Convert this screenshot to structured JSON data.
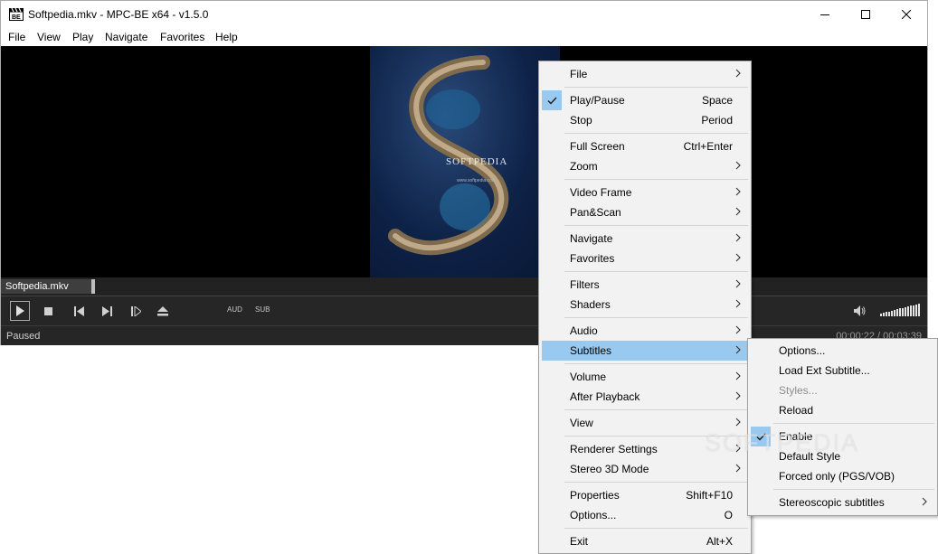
{
  "window": {
    "title": "Softpedia.mkv - MPC-BE x64 - v1.5.0",
    "menu": [
      "File",
      "View",
      "Play",
      "Navigate",
      "Favorites",
      "Help"
    ]
  },
  "video": {
    "art_text": "SOFTPEDIA",
    "art_url": "www.softpedia.com"
  },
  "player": {
    "file_label": "Softpedia.mkv",
    "aud_label": "AUD",
    "sub_label": "SUB",
    "status": "Paused",
    "time": "00:00:22 / 00:03:39",
    "volume_level": 1.0
  },
  "context_menu": {
    "items": [
      {
        "label": "File",
        "shortcut": "",
        "submenu": true,
        "checked": false
      },
      {
        "label": "Play/Pause",
        "shortcut": "Space",
        "submenu": false,
        "checked": true
      },
      {
        "label": "Stop",
        "shortcut": "Period",
        "submenu": false,
        "checked": false
      },
      {
        "label": "Full Screen",
        "shortcut": "Ctrl+Enter",
        "submenu": false,
        "checked": false
      },
      {
        "label": "Zoom",
        "shortcut": "",
        "submenu": true,
        "checked": false
      },
      {
        "label": "Video Frame",
        "shortcut": "",
        "submenu": true,
        "checked": false
      },
      {
        "label": "Pan&Scan",
        "shortcut": "",
        "submenu": true,
        "checked": false
      },
      {
        "label": "Navigate",
        "shortcut": "",
        "submenu": true,
        "checked": false
      },
      {
        "label": "Favorites",
        "shortcut": "",
        "submenu": true,
        "checked": false
      },
      {
        "label": "Filters",
        "shortcut": "",
        "submenu": true,
        "checked": false
      },
      {
        "label": "Shaders",
        "shortcut": "",
        "submenu": true,
        "checked": false
      },
      {
        "label": "Audio",
        "shortcut": "",
        "submenu": true,
        "checked": false
      },
      {
        "label": "Subtitles",
        "shortcut": "",
        "submenu": true,
        "checked": false,
        "highlighted": true
      },
      {
        "label": "Volume",
        "shortcut": "",
        "submenu": true,
        "checked": false
      },
      {
        "label": "After Playback",
        "shortcut": "",
        "submenu": true,
        "checked": false
      },
      {
        "label": "View",
        "shortcut": "",
        "submenu": true,
        "checked": false
      },
      {
        "label": "Renderer Settings",
        "shortcut": "",
        "submenu": true,
        "checked": false
      },
      {
        "label": "Stereo 3D Mode",
        "shortcut": "",
        "submenu": true,
        "checked": false
      },
      {
        "label": "Properties",
        "shortcut": "Shift+F10",
        "submenu": false,
        "checked": false
      },
      {
        "label": "Options...",
        "shortcut": "O",
        "submenu": false,
        "checked": false
      },
      {
        "label": "Exit",
        "shortcut": "Alt+X",
        "submenu": false,
        "checked": false
      }
    ]
  },
  "subtitles_menu": {
    "items": [
      {
        "label": "Options...",
        "disabled": false,
        "checked": false,
        "submenu": false
      },
      {
        "label": "Load Ext Subtitle...",
        "disabled": false,
        "checked": false,
        "submenu": false
      },
      {
        "label": "Styles...",
        "disabled": true,
        "checked": false,
        "submenu": false
      },
      {
        "label": "Reload",
        "disabled": false,
        "checked": false,
        "submenu": false
      },
      {
        "label": "Enable",
        "disabled": false,
        "checked": true,
        "submenu": false
      },
      {
        "label": "Default Style",
        "disabled": false,
        "checked": false,
        "submenu": false
      },
      {
        "label": "Forced only (PGS/VOB)",
        "disabled": false,
        "checked": false,
        "submenu": false
      },
      {
        "label": "Stereoscopic subtitles",
        "disabled": false,
        "checked": false,
        "submenu": true
      }
    ]
  },
  "watermark": "SOFTPEDIA",
  "colors": {
    "highlight": "#99c9ef",
    "menu_bg": "#f2f2f2",
    "player_bg": "#262626"
  }
}
